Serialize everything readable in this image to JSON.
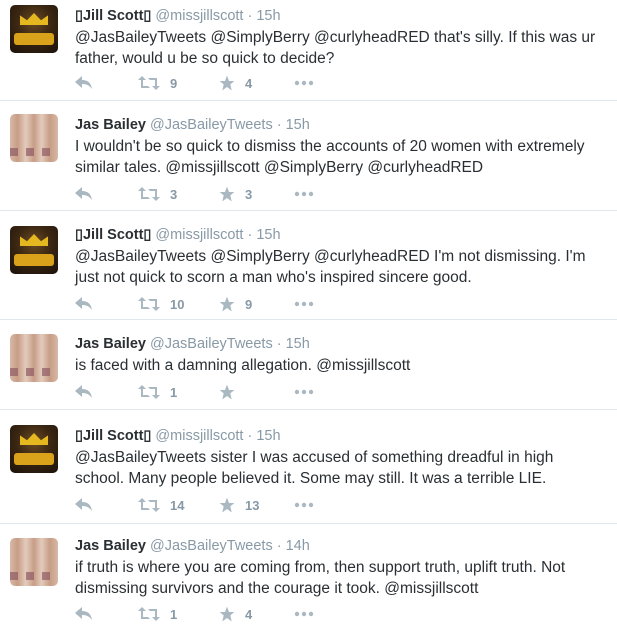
{
  "tweets": [
    {
      "author": "jill",
      "name": "▯Jill Scott▯",
      "handle": "@missjillscott",
      "time": "15h",
      "text": "@JasBaileyTweets @SimplyBerry @curlyheadRED that's silly. If this was ur father, would u be so quick to decide?",
      "retweets": "9",
      "favorites": "4"
    },
    {
      "author": "jas",
      "name": "Jas Bailey",
      "handle": "@JasBaileyTweets",
      "time": "15h",
      "text": "I wouldn't be so quick to dismiss the accounts of 20 women with extremely similar tales.  @missjillscott @SimplyBerry @curlyheadRED",
      "retweets": "3",
      "favorites": "3"
    },
    {
      "author": "jill",
      "name": "▯Jill Scott▯",
      "handle": "@missjillscott",
      "time": "15h",
      "text": "@JasBaileyTweets @SimplyBerry @curlyheadRED I'm not dismissing. I'm just not quick to scorn a man who's inspired sincere good.",
      "retweets": "10",
      "favorites": "9"
    },
    {
      "author": "jas",
      "name": "Jas Bailey",
      "handle": "@JasBaileyTweets",
      "time": "15h",
      "text": "is faced with a damning allegation. @missjillscott",
      "retweets": "1",
      "favorites": ""
    },
    {
      "author": "jill",
      "name": "▯Jill Scott▯",
      "handle": "@missjillscott",
      "time": "15h",
      "text": "@JasBaileyTweets sister I was accused of something dreadful in high school. Many people believed it. Some may still. It was a terrible LIE.",
      "retweets": "14",
      "favorites": "13"
    },
    {
      "author": "jas",
      "name": "Jas Bailey",
      "handle": "@JasBaileyTweets",
      "time": "14h",
      "text": "if truth is where you are coming from, then support truth, uplift truth. Not dismissing survivors and the courage it took. @missjillscott",
      "retweets": "1",
      "favorites": "4"
    }
  ],
  "separator": " · ",
  "icons": {
    "reply": "reply-icon",
    "retweet": "retweet-icon",
    "favorite": "star-icon",
    "more": "more-icon"
  },
  "colors": {
    "text": "#292f33",
    "meta": "#8899a6",
    "icon": "#aab8c2",
    "divider": "#e1e8ed"
  }
}
